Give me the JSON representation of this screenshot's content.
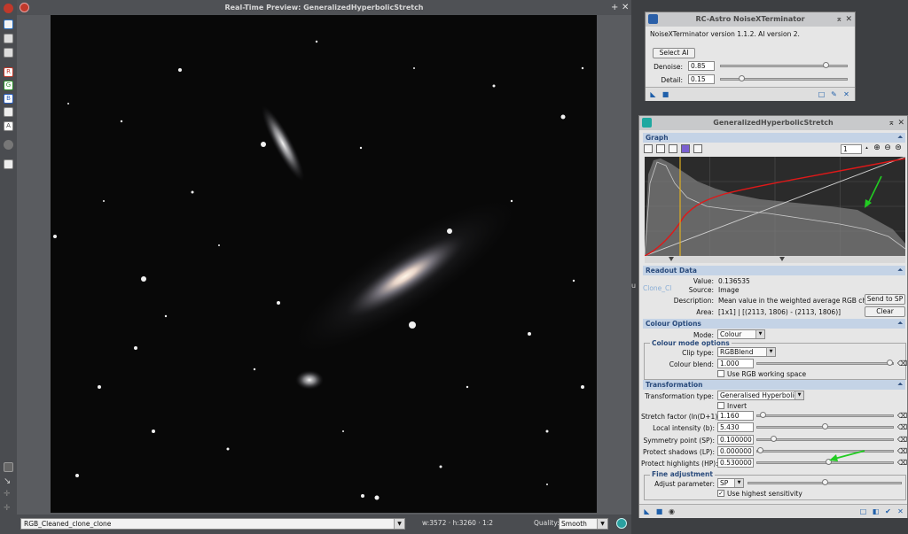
{
  "preview": {
    "title": "Real-Time Preview: GeneralizedHyperbolicStretch",
    "add_btn": "+",
    "close_btn": "✕",
    "view_name": "RGB_Cleaned_clone_clone",
    "dims": "w:3572 · h:3260 · 1:2",
    "quality_label": "Quality:",
    "quality_value": "Smooth"
  },
  "left_toolbar": {
    "channel_r": "R",
    "channel_g": "G",
    "channel_b": "B",
    "channel_a": "A"
  },
  "nxt": {
    "title": "RC-Astro NoiseXTerminator",
    "version_text": "NoiseXTerminator version 1.1.2. AI version 2.",
    "select_ai": "Select AI",
    "denoise_label": "Denoise:",
    "denoise_value": "0.85",
    "denoise_level": 0.85,
    "detail_label": "Detail:",
    "detail_value": "0.15",
    "detail_level": 0.15
  },
  "ghs": {
    "title": "GeneralizedHyperbolicStretch",
    "graph_header": "Graph",
    "zoom_value": "1",
    "readout_header": "Readout Data",
    "value_label": "Value:",
    "value": "0.136535",
    "source_label": "Source:",
    "source": "Image",
    "description_label": "Description:",
    "description": "Mean value in the weighted average RGB channel",
    "send_to_sp": "Send to SP",
    "area_label": "Area:",
    "area": "[1x1] | [(2113, 1806) - (2113, 1806)]",
    "clear": "Clear",
    "colour_header": "Colour Options",
    "mode_label": "Mode:",
    "mode_value": "Colour",
    "colour_mode_group": "Colour mode options",
    "clip_type_label": "Clip type:",
    "clip_type_value": "RGBBlend",
    "colour_blend_label": "Colour blend:",
    "colour_blend_value": "1.000",
    "colour_blend_level": 1.0,
    "use_rgb_ws": "Use RGB working space",
    "transformation_header": "Transformation",
    "transformation_type_label": "Transformation type:",
    "transformation_type_value": "Generalised Hyperbolic",
    "invert": "Invert",
    "stretch_factor_label": "Stretch factor (ln(D+1)):",
    "stretch_factor_value": "1.160",
    "stretch_factor_level": 0.02,
    "local_intensity_label": "Local intensity (b):",
    "local_intensity_value": "5.430",
    "local_intensity_level": 0.5,
    "symmetry_label": "Symmetry point (SP):",
    "symmetry_value": "0.100000",
    "symmetry_level": 0.1,
    "protect_shadows_label": "Protect shadows (LP):",
    "protect_shadows_value": "0.000000",
    "protect_shadows_level": 0.0,
    "protect_highlights_label": "Protect highlights (HP):",
    "protect_highlights_value": "0.530000",
    "protect_highlights_level": 0.53,
    "fine_adjustment_group": "Fine adjustment",
    "adjust_parameter_label": "Adjust parameter:",
    "adjust_parameter_value": "SP",
    "use_highest_sensitivity": "Use highest sensitivity",
    "check_mark": "✓"
  },
  "colors": {
    "accent": "#2a4b7c",
    "section_bg": "#c4d3e6",
    "curve": "#e01818",
    "sp_line": "#e0b020",
    "annotation_arrow": "#22cc22"
  },
  "background_label": "Clone_Cl",
  "side_label": "u"
}
